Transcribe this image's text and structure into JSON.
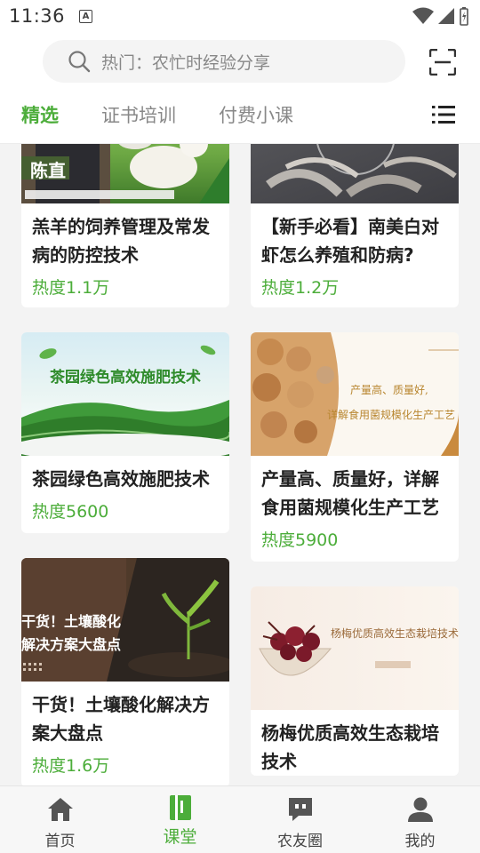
{
  "status": {
    "time": "11:36",
    "notification_letter": "A"
  },
  "search": {
    "placeholder": "热门：农忙时经验分享"
  },
  "tabs": [
    {
      "label": "精选",
      "active": true
    },
    {
      "label": "证书培训",
      "active": false
    },
    {
      "label": "付费小课",
      "active": false
    }
  ],
  "cards": [
    {
      "title": "羔羊的饲养管理及常发病的防控技术",
      "heat": "热度1.1万",
      "image_text": "陈直"
    },
    {
      "title": "【新手必看】南美白对虾怎么养殖和防病?",
      "heat": "热度1.2万"
    },
    {
      "title": "茶园绿色高效施肥技术",
      "heat": "热度5600",
      "image_text": "茶园绿色高效施肥技术"
    },
    {
      "title": "产量高、质量好，详解食用菌规模化生产工艺",
      "heat": "热度5900",
      "image_text_1": "产量高、质量好,",
      "image_text_2": "详解食用菌规模化生产工艺"
    },
    {
      "title": "干货！土壤酸化解决方案大盘点",
      "heat": "热度1.6万",
      "image_text_1": "干货！土壤酸化",
      "image_text_2": "解决方案大盘点"
    },
    {
      "title": "杨梅优质高效生态栽培技术",
      "image_text": "杨梅优质高效生态栽培技术"
    }
  ],
  "nav": [
    {
      "label": "首页",
      "icon": "home-icon"
    },
    {
      "label": "课堂",
      "icon": "book-icon",
      "active": true
    },
    {
      "label": "农友圈",
      "icon": "chat-bubble-icon"
    },
    {
      "label": "我的",
      "icon": "person-icon"
    }
  ],
  "colors": {
    "accent": "#4cad3a",
    "text": "#222222",
    "muted": "#888888"
  }
}
